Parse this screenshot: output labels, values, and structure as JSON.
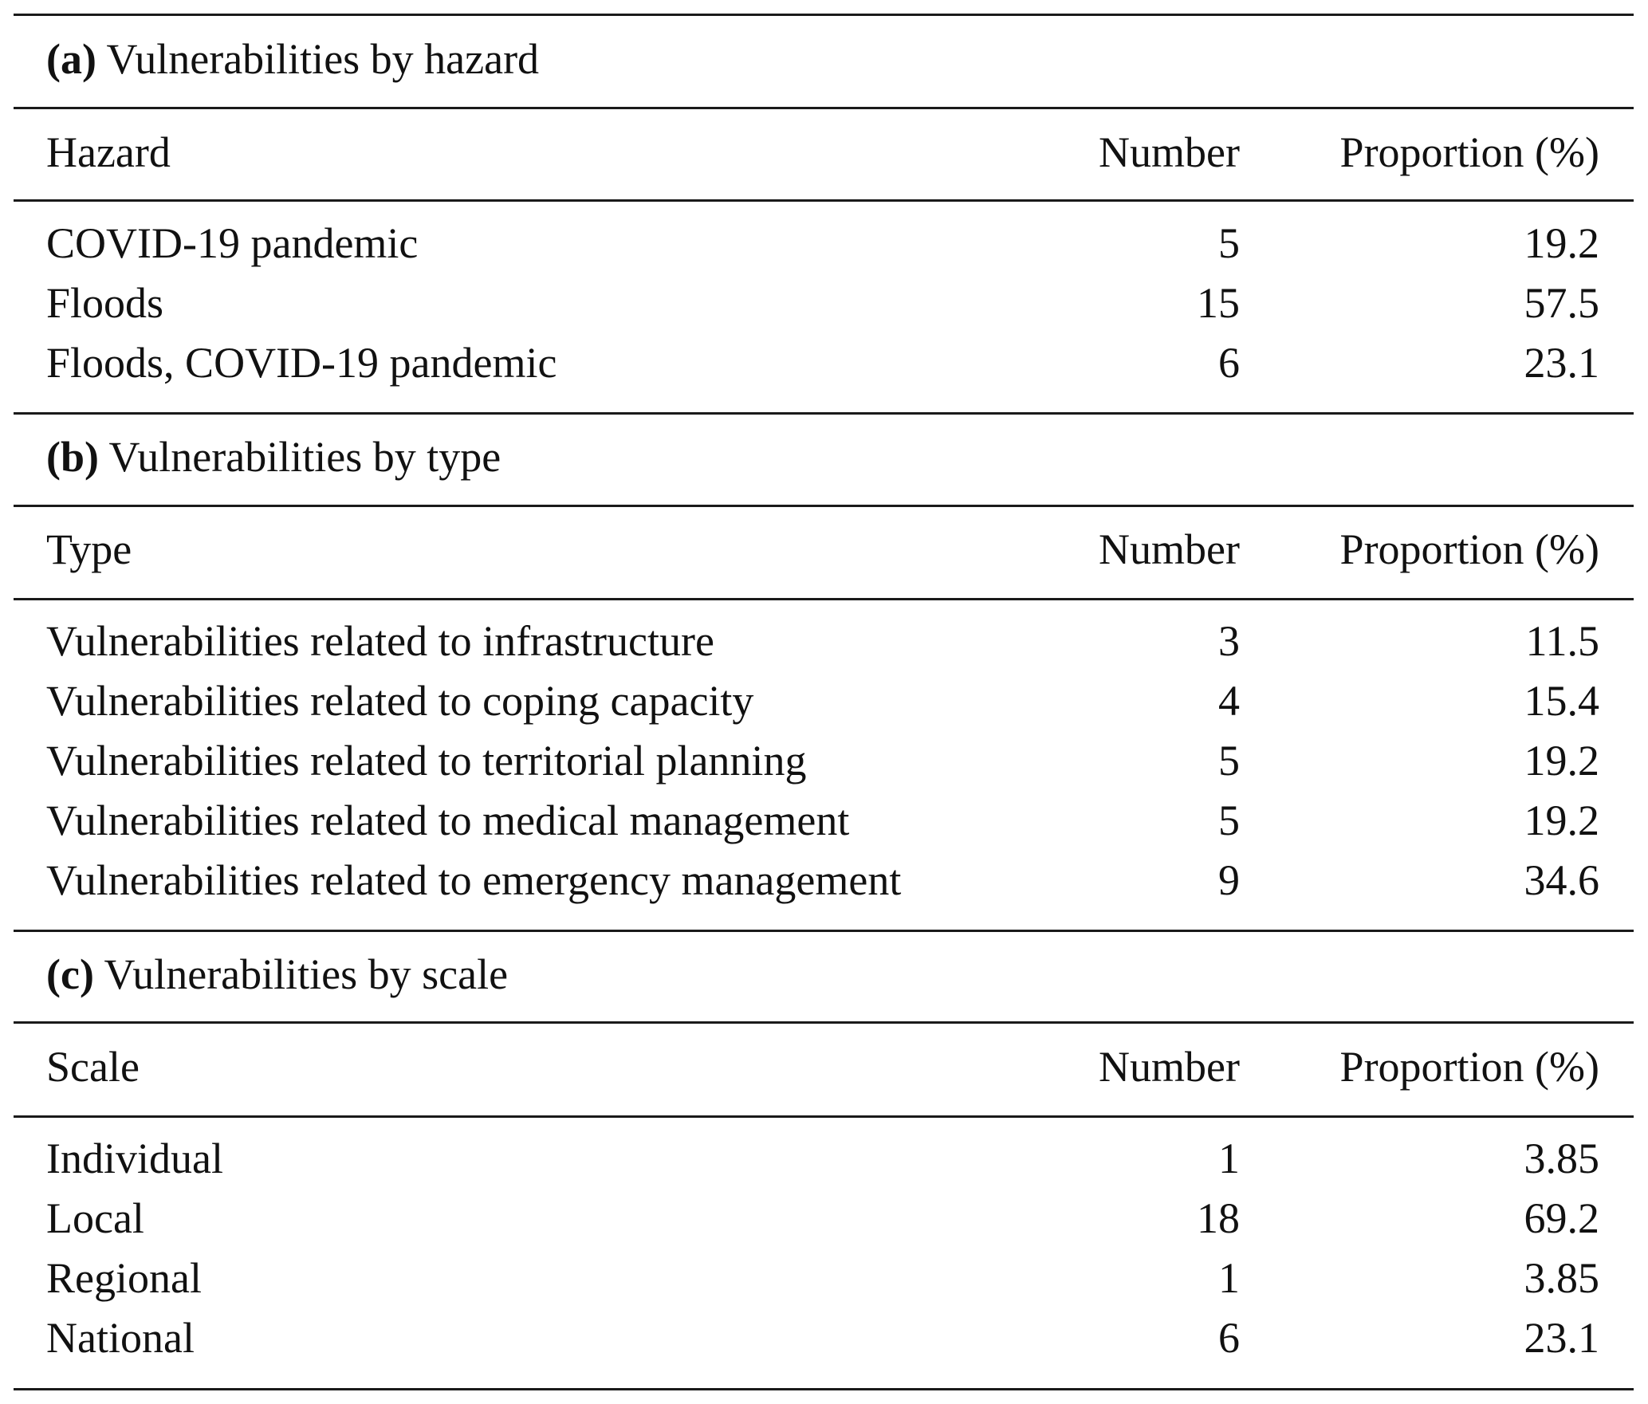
{
  "sections": [
    {
      "label": "(a)",
      "title": "Vulnerabilities by hazard",
      "headers": [
        "Hazard",
        "Number",
        "Proportion (%)"
      ],
      "rows": [
        [
          "COVID-19 pandemic",
          "5",
          "19.2"
        ],
        [
          "Floods",
          "15",
          "57.5"
        ],
        [
          "Floods, COVID-19 pandemic",
          "6",
          "23.1"
        ]
      ]
    },
    {
      "label": "(b)",
      "title": "Vulnerabilities by type",
      "headers": [
        "Type",
        "Number",
        "Proportion (%)"
      ],
      "rows": [
        [
          "Vulnerabilities related to infrastructure",
          "3",
          "11.5"
        ],
        [
          "Vulnerabilities related to coping capacity",
          "4",
          "15.4"
        ],
        [
          "Vulnerabilities related to territorial planning",
          "5",
          "19.2"
        ],
        [
          "Vulnerabilities related to medical management",
          "5",
          "19.2"
        ],
        [
          "Vulnerabilities related to emergency management",
          "9",
          "34.6"
        ]
      ]
    },
    {
      "label": "(c)",
      "title": "Vulnerabilities by scale",
      "headers": [
        "Scale",
        "Number",
        "Proportion (%)"
      ],
      "rows": [
        [
          "Individual",
          "1",
          "3.85"
        ],
        [
          "Local",
          "18",
          "69.2"
        ],
        [
          "Regional",
          "1",
          "3.85"
        ],
        [
          "National",
          "6",
          "23.1"
        ]
      ]
    }
  ]
}
